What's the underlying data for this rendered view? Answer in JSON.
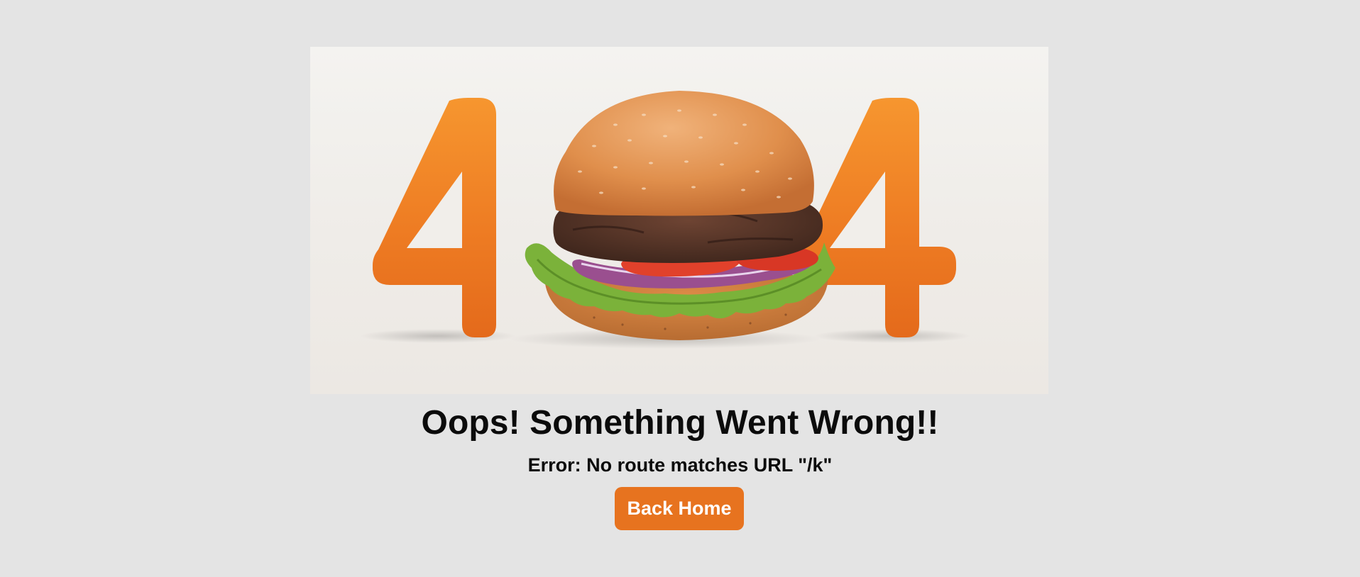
{
  "hero": {
    "number_text": "404",
    "image_description_icon": "burger-404-illustration",
    "digit_color": "#ed7a22"
  },
  "message": {
    "title": "Oops! Something Went Wrong!!",
    "error": "Error: No route matches URL \"/k\""
  },
  "actions": {
    "back_home_label": "Back Home"
  },
  "colors": {
    "page_bg": "#e4e4e4",
    "accent": "#e7731f",
    "button_text": "#ffffff",
    "text": "#0b0b0b"
  }
}
